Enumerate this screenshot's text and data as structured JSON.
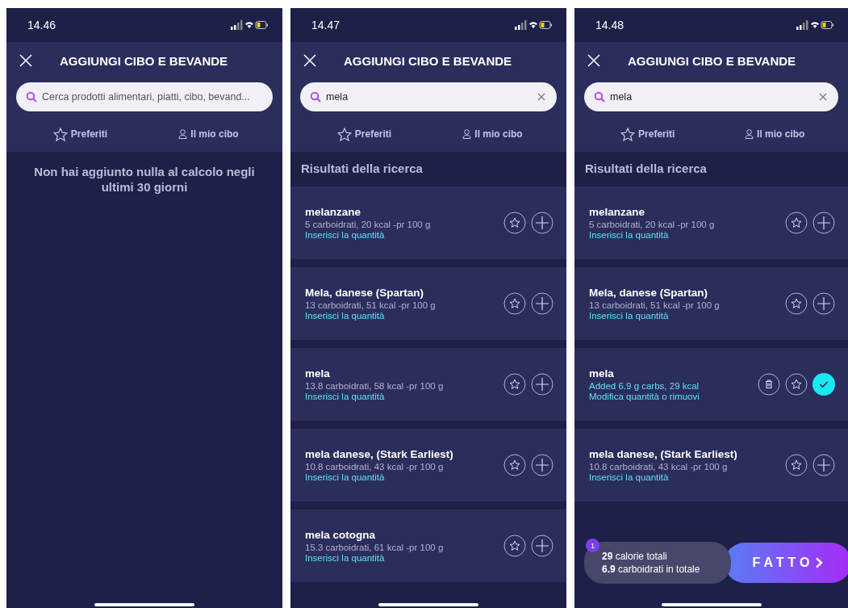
{
  "screens": [
    {
      "time": "14.46",
      "title": "AGGIUNGI CIBO E BEVANDE",
      "search": {
        "placeholder": "Cerca prodotti alimentari, piatti, cibo, bevand..."
      },
      "tabs": [
        {
          "label": "Preferiti",
          "kind": "star"
        },
        {
          "label": "Il mio cibo",
          "kind": "person"
        }
      ],
      "empty_message": "Non hai aggiunto nulla al calcolo negli ultimi 30 giorni"
    },
    {
      "time": "14.47",
      "title": "AGGIUNGI CIBO E BEVANDE",
      "search": {
        "value": "mela"
      },
      "tabs": [
        {
          "label": "Preferiti",
          "kind": "star"
        },
        {
          "label": "Il mio cibo",
          "kind": "person"
        }
      ],
      "results_heading": "Risultati della ricerca",
      "results": [
        {
          "name": "melanzane",
          "detail": "5 carboidrati, 20 kcal -pr 100 g",
          "action": "Inserisci la quantità",
          "added": false
        },
        {
          "name": "Mela, danese (Spartan)",
          "detail": "13 carboidrati, 51 kcal -pr 100 g",
          "action": "Inserisci la quantità",
          "added": false
        },
        {
          "name": "mela",
          "detail": "13.8 carboidrati, 58 kcal -pr 100 g",
          "action": "Inserisci la quantità",
          "added": false
        },
        {
          "name": "mela danese, (Stark Earliest)",
          "detail": "10.8 carboidrati, 43 kcal -pr 100 g",
          "action": "Inserisci la quantità",
          "added": false
        },
        {
          "name": "mela cotogna",
          "detail": "15.3 carboidrati, 61 kcal -pr 100 g",
          "action": "Inserisci la quantità",
          "added": false
        }
      ]
    },
    {
      "time": "14.48",
      "title": "AGGIUNGI CIBO E BEVANDE",
      "search": {
        "value": "mela"
      },
      "tabs": [
        {
          "label": "Preferiti",
          "kind": "star"
        },
        {
          "label": "Il mio cibo",
          "kind": "person"
        }
      ],
      "results_heading": "Risultati della ricerca",
      "results": [
        {
          "name": "melanzane",
          "detail": "5 carboidrati, 20 kcal -pr 100 g",
          "action": "Inserisci la quantità",
          "added": false
        },
        {
          "name": "Mela, danese (Spartan)",
          "detail": "13 carboidrati, 51 kcal -pr 100 g",
          "action": "Inserisci la quantità",
          "added": false
        },
        {
          "name": "mela",
          "detail": "Added 6.9 g carbs, 29 kcal",
          "action": "Modifica quantità o rimuovi",
          "added": true
        },
        {
          "name": "mela danese, (Stark Earliest)",
          "detail": "10.8 carboidrati, 43 kcal -pr 100 g",
          "action": "Inserisci la quantità",
          "added": false
        }
      ],
      "summary": {
        "count": "1",
        "lines": [
          "**29**  calorie totali",
          "**6.9**  carboidrati in totale"
        ],
        "done_button": "FATTO"
      }
    }
  ]
}
